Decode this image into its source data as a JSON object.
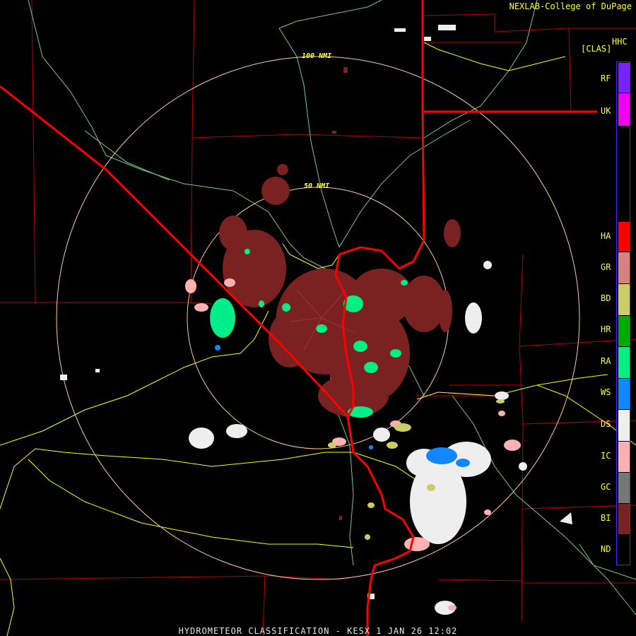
{
  "header": {
    "credit": "NEXLAB-College of DuPage",
    "product_code": "HHC",
    "product_label": "[CLAS]"
  },
  "footer": {
    "caption": "HYDROMETEOR CLASSIFICATION - KESX 1 JAN 26 12:02"
  },
  "rings": [
    {
      "label": "100 NMI"
    },
    {
      "label": "50 NMI"
    }
  ],
  "legend": {
    "categories": [
      {
        "code": "RF",
        "color": "#7722ff"
      },
      {
        "code": "UK",
        "color": "#ee00ee"
      },
      {
        "code": "HA",
        "color": "#ff0000"
      },
      {
        "code": "GR",
        "color": "#d98080"
      },
      {
        "code": "BD",
        "color": "#cccc66"
      },
      {
        "code": "HR",
        "color": "#00aa00"
      },
      {
        "code": "RA",
        "color": "#00ee88"
      },
      {
        "code": "WS",
        "color": "#1188ff"
      },
      {
        "code": "DS",
        "color": "#eeeeee"
      },
      {
        "code": "IC",
        "color": "#ffb0b0"
      },
      {
        "code": "GC",
        "color": "#777777"
      },
      {
        "code": "BI",
        "color": "#7a2222"
      },
      {
        "code": "ND",
        "color": "#000000"
      }
    ]
  },
  "colors": {
    "state_border": "#ff0000",
    "county_border": "#bb0000",
    "highway": "#ffff00",
    "river": "#77cc77",
    "range_ring": "#ffcc99",
    "legend_border": "#5522ff"
  }
}
